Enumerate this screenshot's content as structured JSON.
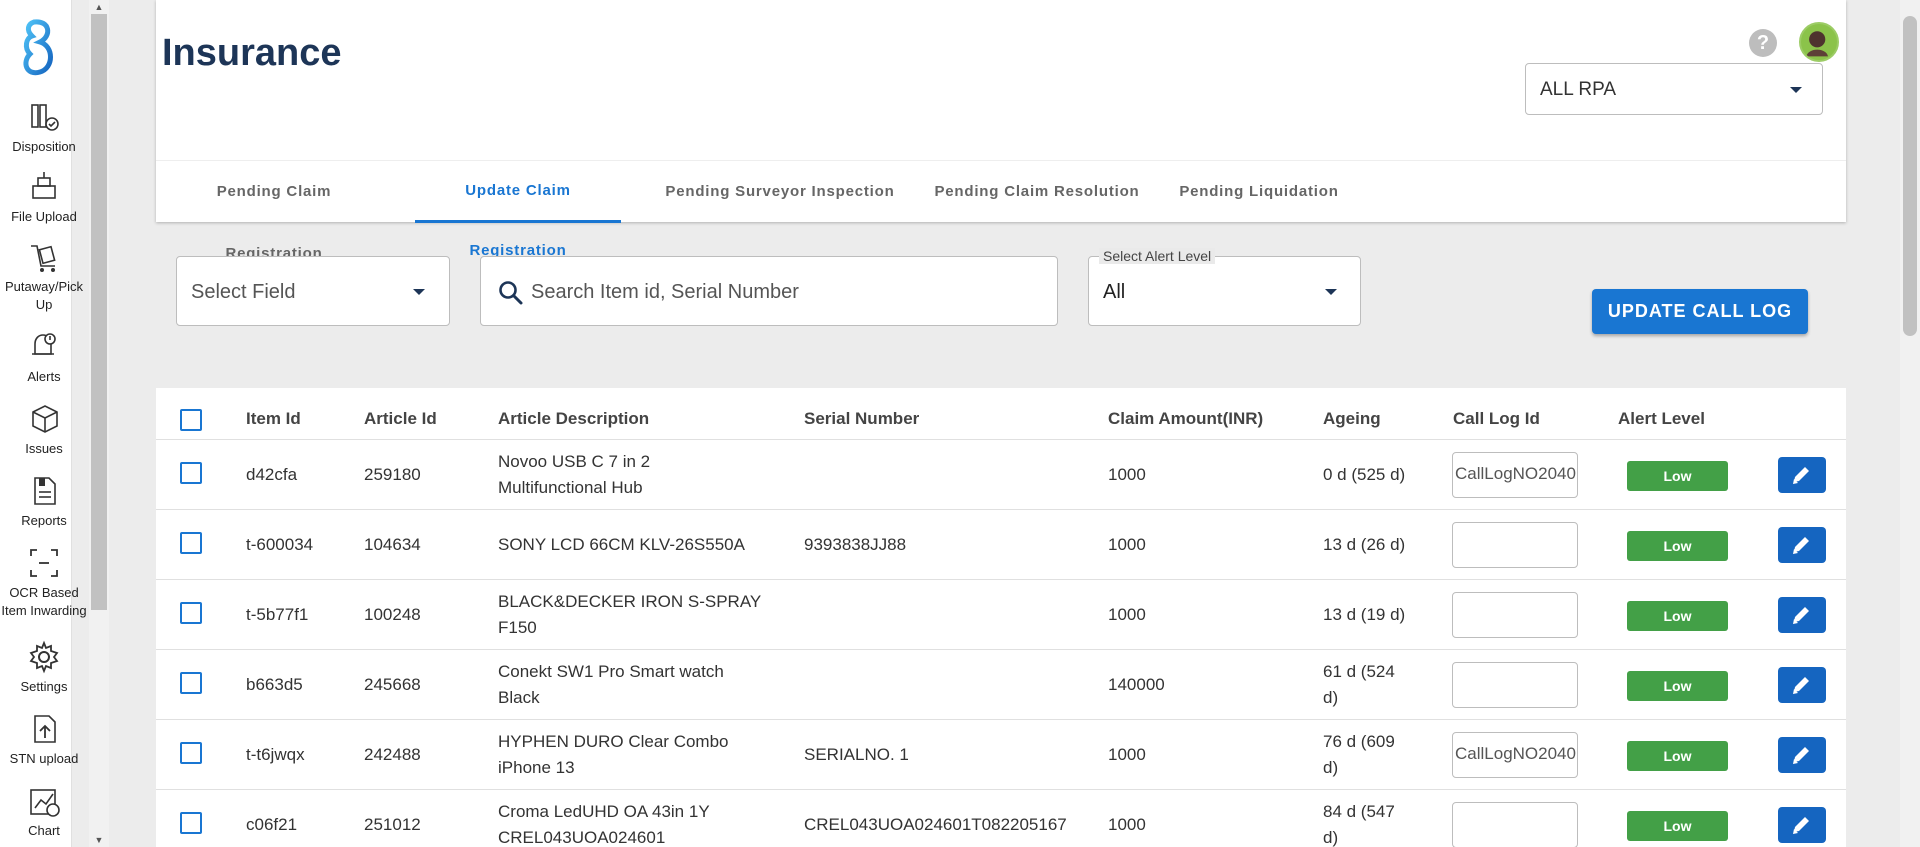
{
  "sidebar": {
    "items": [
      {
        "label_lines": [
          "Disposition"
        ],
        "icon": "disposition-icon"
      },
      {
        "label_lines": [
          "File Upload"
        ],
        "icon": "file-upload-icon"
      },
      {
        "label_lines": [
          "Putaway/Pick",
          "Up"
        ],
        "icon": "putaway-icon"
      },
      {
        "label_lines": [
          "Alerts"
        ],
        "icon": "alerts-icon"
      },
      {
        "label_lines": [
          "Issues"
        ],
        "icon": "issues-icon"
      },
      {
        "label_lines": [
          "Reports"
        ],
        "icon": "reports-icon"
      },
      {
        "label_lines": [
          "OCR Based",
          "Item Inwarding"
        ],
        "icon": "ocr-icon"
      },
      {
        "label_lines": [
          "Settings"
        ],
        "icon": "gear-icon"
      },
      {
        "label_lines": [
          "STN upload"
        ],
        "icon": "stn-upload-icon"
      },
      {
        "label_lines": [
          "Chart"
        ],
        "icon": "chart-icon"
      }
    ]
  },
  "header": {
    "title": "Insurance",
    "help": "?",
    "rpa_select": "ALL RPA"
  },
  "tabs": [
    {
      "label": "Pending Claim Registration",
      "active": false
    },
    {
      "label": "Update Claim Registration",
      "active": true
    },
    {
      "label": "Pending Surveyor Inspection",
      "active": false
    },
    {
      "label": "Pending Claim Resolution",
      "active": false
    },
    {
      "label": "Pending Liquidation",
      "active": false
    }
  ],
  "filters": {
    "select_field": "Select Field",
    "search_placeholder": "Search Item id, Serial Number",
    "alert_level_label": "Select Alert Level",
    "alert_level_value": "All",
    "update_button": "UPDATE CALL LOG"
  },
  "table": {
    "headers": [
      "Item Id",
      "Article Id",
      "Article Description",
      "Serial Number",
      "Claim Amount(INR)",
      "Ageing",
      "Call Log Id",
      "Alert Level"
    ],
    "rows": [
      {
        "item_id": "d42cfa",
        "article_id": "259180",
        "desc1": "Novoo USB C 7 in 2",
        "desc2": "Multifunctional Hub",
        "serial": "",
        "amount": "1000",
        "age1": "0 d (525 d)",
        "age2": "",
        "call_log": "CallLogNO2040",
        "alert": "Low"
      },
      {
        "item_id": "t-600034",
        "article_id": "104634",
        "desc1": "SONY LCD 66CM KLV-26S550A",
        "desc2": "",
        "serial": "9393838JJ88",
        "amount": "1000",
        "age1": "13 d (26 d)",
        "age2": "",
        "call_log": "",
        "alert": "Low"
      },
      {
        "item_id": "t-5b77f1",
        "article_id": "100248",
        "desc1": "BLACK&DECKER IRON S-SPRAY",
        "desc2": "F150",
        "serial": "",
        "amount": "1000",
        "age1": "13 d (19 d)",
        "age2": "",
        "call_log": "",
        "alert": "Low"
      },
      {
        "item_id": "b663d5",
        "article_id": "245668",
        "desc1": "Conekt SW1 Pro Smart watch",
        "desc2": "Black",
        "serial": "",
        "amount": "140000",
        "age1": "61 d (524",
        "age2": "d)",
        "call_log": "",
        "alert": "Low"
      },
      {
        "item_id": "t-t6jwqx",
        "article_id": "242488",
        "desc1": "HYPHEN DURO Clear Combo",
        "desc2": "iPhone 13",
        "serial": "SERIALNO. 1",
        "amount": "1000",
        "age1": "76 d (609",
        "age2": "d)",
        "call_log": "CallLogNO2040",
        "alert": "Low"
      },
      {
        "item_id": "c06f21",
        "article_id": "251012",
        "desc1": "Croma LedUHD OA 43in 1Y",
        "desc2": "CREL043UOA024601",
        "serial": "CREL043UOA024601T082205167",
        "amount": "1000",
        "age1": "84 d (547",
        "age2": "d)",
        "call_log": "",
        "alert": "Low"
      }
    ]
  },
  "colors": {
    "title": "#1d3557",
    "primary": "#1976d2",
    "edit_button": "#1565c0",
    "alert_low": "#43a047"
  }
}
